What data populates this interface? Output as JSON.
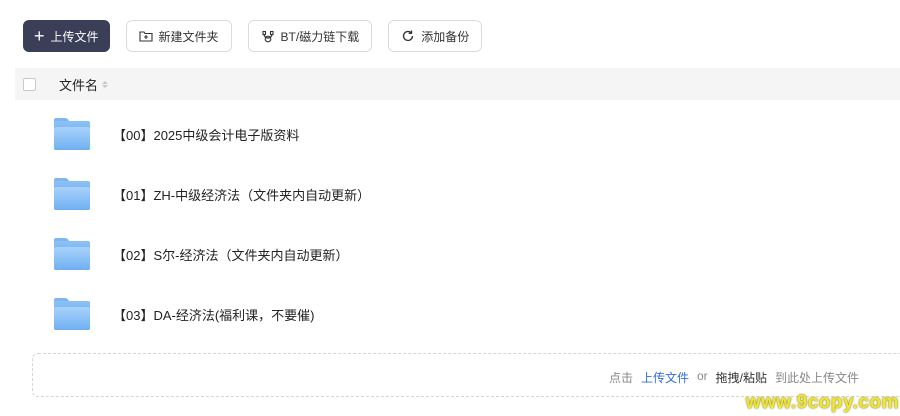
{
  "toolbar": {
    "upload_label": "上传文件",
    "new_folder_label": "新建文件夹",
    "bt_label": "BT/磁力链下载",
    "backup_label": "添加备份"
  },
  "table": {
    "column_name": "文件名"
  },
  "files": [
    {
      "name": "【00】2025中级会计电子版资料",
      "icon": "folder-icon"
    },
    {
      "name": "【01】ZH-中级经济法（文件夹内自动更新）",
      "icon": "folder-icon"
    },
    {
      "name": "【02】S尔-经济法（文件夹内自动更新）",
      "icon": "folder-icon"
    },
    {
      "name": "【03】DA-经济法(福利课，不要催)",
      "icon": "folder-icon"
    }
  ],
  "dropzone": {
    "click": "点击",
    "upload_link": "上传文件",
    "or": "or",
    "drag_paste": "拖拽/粘贴",
    "suffix": "到此处上传文件"
  },
  "watermark": "www.9copy.com",
  "colors": {
    "primary_button": "#3a3f57",
    "link": "#2f6fdc",
    "folder": "#6fb0f2",
    "watermark": "#f0e63a"
  }
}
